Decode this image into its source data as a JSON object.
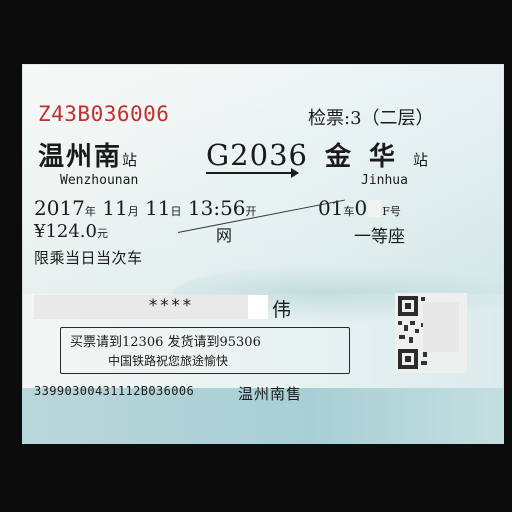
{
  "ticket": {
    "serial": "Z43B036006",
    "gate": "检票:3（二层）",
    "from_station": "温州南",
    "station_suffix": "站",
    "from_pinyin": "Wenzhounan",
    "train_no": "G2036",
    "to_station": "金华",
    "to_pinyin": "Jinhua",
    "date_year": "2017",
    "date_year_unit": "年",
    "date_month": "11",
    "date_month_unit": "月",
    "date_day": "11",
    "date_day_unit": "日",
    "time": "13:56",
    "time_unit": "开",
    "car_no": "01",
    "car_unit": "车",
    "seat_visible": "0",
    "seat_suffix": "F号",
    "price": "¥124.0",
    "price_unit": "元",
    "purchase_channel": "网",
    "seat_class": "一等座",
    "note": "限乘当日当次车",
    "passenger_id_visible": "****",
    "passenger_name_visible": "伟",
    "notice_line1": "买票请到12306 发货请到95306",
    "notice_line2": "中国铁路祝您旅途愉快",
    "ticket_code": "33990300431112B036006",
    "sale_station": "温州南售"
  },
  "colors": {
    "serial": "#c0302f",
    "ticket_bg": "#e8f2f1",
    "bottom_strip": "#b9d7db"
  }
}
